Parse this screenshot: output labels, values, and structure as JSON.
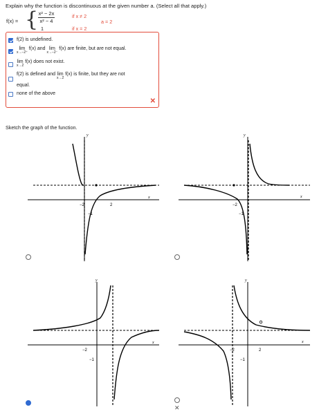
{
  "question": {
    "prompt": "Explain why the function is discontinuous at the given number a. (Select all that apply.)",
    "fx_label": "f(x) =",
    "piece1_num": "x² − 2x",
    "piece1_den": "x² − 4",
    "piece1_cond": "if x ≠ 2",
    "piece2_val": "1",
    "piece2_cond": "if x = 2",
    "a_value": "a = 2"
  },
  "choices": {
    "opt1": "f(2) is undefined.",
    "opt2_lim": "lim",
    "opt2_sub1": "x→−2⁺",
    "opt2_mid": "f(x) and",
    "opt2_sub2": "x→−2⁻",
    "opt2_end": "f(x) are finite, but are not equal.",
    "opt3_lim": "lim",
    "opt3_sub": "x→2",
    "opt3_end": "f(x) does not exist.",
    "opt4_a": "f(2) is defined and",
    "opt4_lim": "lim",
    "opt4_sub": "x→2",
    "opt4_b": "f(x) is finite, but they are not",
    "opt4_c": "equal.",
    "opt5": "none of the above",
    "checked": [
      true,
      true,
      false,
      false,
      false
    ]
  },
  "sketch": {
    "title": "Sketch the graph of the function.",
    "graph_labels": {
      "x": "x",
      "y": "y",
      "neg2": "−2",
      "two": "2",
      "neg1": "−1"
    },
    "selected_option": 3
  },
  "colors": {
    "accent_red": "#e24b3a",
    "check_blue": "#2f6ad1"
  }
}
